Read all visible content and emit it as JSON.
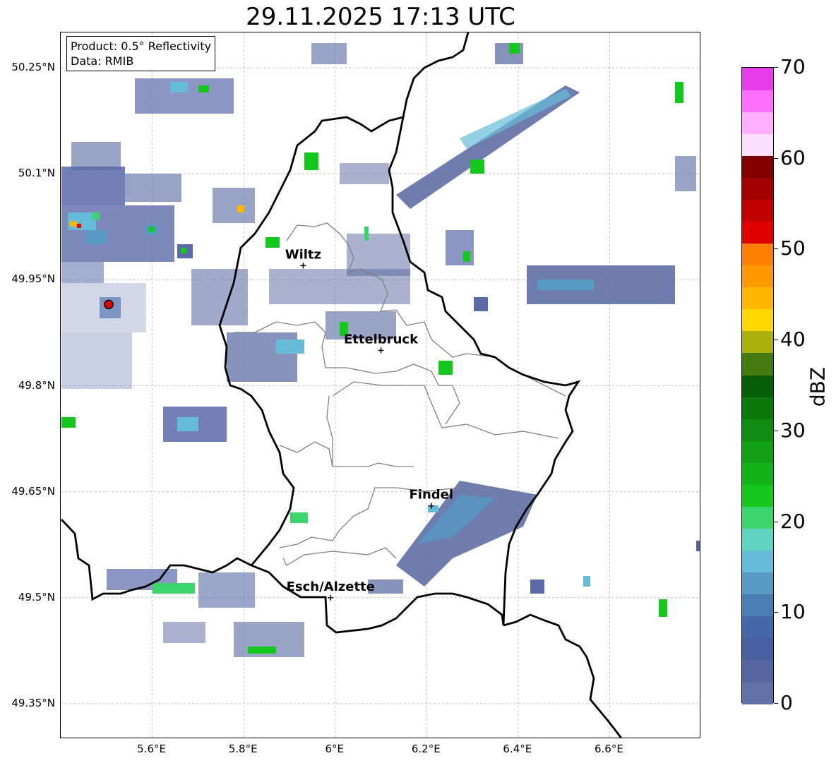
{
  "title": "29.11.2025 17:13 UTC",
  "product_info": {
    "line1": "Product: 0.5° Reflectivity",
    "line2": "Data: RMIB"
  },
  "map": {
    "lon_range": [
      5.4,
      6.8
    ],
    "lat_range": [
      49.3,
      50.3
    ],
    "lat_ticks": [
      {
        "value": 50.25,
        "label": "50.25°N"
      },
      {
        "value": 50.1,
        "label": "50.1°N"
      },
      {
        "value": 49.95,
        "label": "49.95°N"
      },
      {
        "value": 49.8,
        "label": "49.8°N"
      },
      {
        "value": 49.65,
        "label": "49.65°N"
      },
      {
        "value": 49.5,
        "label": "49.5°N"
      },
      {
        "value": 49.35,
        "label": "49.35°N"
      }
    ],
    "lon_ticks": [
      {
        "value": 5.6,
        "label": "5.6°E"
      },
      {
        "value": 5.8,
        "label": "5.8°E"
      },
      {
        "value": 6.0,
        "label": "6°E"
      },
      {
        "value": 6.2,
        "label": "6.2°E"
      },
      {
        "value": 6.4,
        "label": "6.4°E"
      },
      {
        "value": 6.6,
        "label": "6.6°E"
      }
    ],
    "cities": [
      {
        "name": "Wiltz",
        "lon": 5.93,
        "lat": 49.97
      },
      {
        "name": "Ettelbruck",
        "lon": 6.1,
        "lat": 49.85
      },
      {
        "name": "Findel",
        "lon": 6.21,
        "lat": 49.63
      },
      {
        "name": "Esch/Alzette",
        "lon": 5.99,
        "lat": 49.5
      }
    ],
    "radar_site": {
      "name": "radar-site",
      "lon": 5.505,
      "lat": 49.915,
      "color": "#e00000"
    }
  },
  "colorbar": {
    "label": "dBZ",
    "min": 0,
    "max": 70,
    "ticks": [
      "0",
      "10",
      "20",
      "30",
      "40",
      "50",
      "60",
      "70"
    ],
    "colors": [
      "#6272a6",
      "#5565a0",
      "#4a5fa0",
      "#4668a8",
      "#4a7db2",
      "#579ac4",
      "#66bcd8",
      "#60d4c0",
      "#3cd46c",
      "#14c81e",
      "#12b41a",
      "#12a014",
      "#108c10",
      "#0c780c",
      "#085e08",
      "#447a10",
      "#acb00a",
      "#fed700",
      "#feb600",
      "#fe9a00",
      "#fe7e00",
      "#e00000",
      "#c00000",
      "#a00000",
      "#800000",
      "#fee0fe",
      "#feb0fe",
      "#fe70fe",
      "#e83ce8"
    ]
  }
}
